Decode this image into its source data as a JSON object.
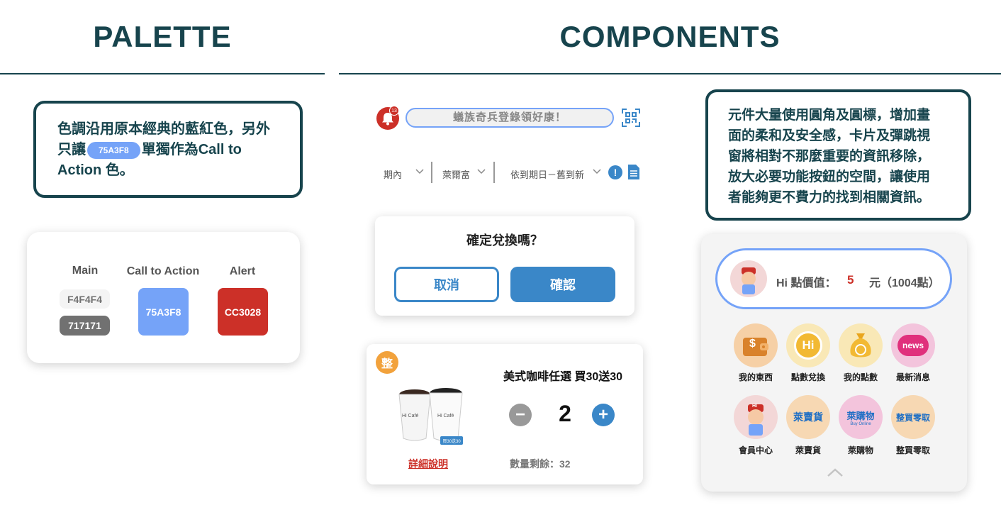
{
  "headings": {
    "palette": "PALETTE",
    "components": "COMPONENTS"
  },
  "palette_note": {
    "line1": "色調沿用原本經典的藍紅色，另外",
    "line2_pre": "只讓",
    "line2_pill": "75A3F8",
    "line2_post": "單獨作為Call to",
    "line3": "Action 色。"
  },
  "palette_card": {
    "main_label": "Main",
    "cta_label": "Call to Action",
    "alert_label": "Alert",
    "main_light": "F4F4F4",
    "main_dark": "717171",
    "cta": "75A3F8",
    "alert": "CC3028"
  },
  "colors": {
    "dark_teal": "#17444d",
    "main_light": "#F4F4F4",
    "main_dark": "#717171",
    "cta": "#75A3F8",
    "alert": "#CC3028",
    "primary_blue": "#3A87C8",
    "orange": "#F2A23C"
  },
  "topbar": {
    "badge_count": "13",
    "search_text": "蟻族奇兵登錄領好康！",
    "bell_icon": "bell-icon",
    "qr_icon": "qr-scan-icon"
  },
  "filters": {
    "period": "期內",
    "store": "萊爾富",
    "sort": "依到期日－舊到新"
  },
  "confirm_dialog": {
    "title": "確定兌換嗎？",
    "cancel": "取消",
    "confirm": "確認"
  },
  "product_card": {
    "badge": "整",
    "title": "美式咖啡任選 買30送30",
    "quantity": "2",
    "details_link": "詳細說明",
    "remaining": "數量剩餘：32",
    "tag": "買30送30",
    "cup_brand": "Hi Café"
  },
  "components_note": {
    "line1": "元件大量使用圓角及圓標，增加畫",
    "line2": "面的柔和及安全感，卡片及彈跳視",
    "line3": "窗將相對不那麼重要的資訊移除，",
    "line4": "放大必要功能按鈕的空間，讓使用",
    "line5": "者能夠更不費力的找到相關資訊。"
  },
  "points": {
    "label": "Hi 點價值：",
    "value": "5",
    "unit": "元（1004點）"
  },
  "menu": [
    {
      "label": "我的東西",
      "icon": "wallet-icon"
    },
    {
      "label": "點數兌換",
      "icon": "hi-coin-icon"
    },
    {
      "label": "我的點數",
      "icon": "money-bag-icon"
    },
    {
      "label": "最新消息",
      "icon": "news-icon"
    },
    {
      "label": "會員中心",
      "icon": "mascot-icon"
    },
    {
      "label": "萊賣貨",
      "icon": "lai-sell-icon",
      "logo_text": "萊賣貨"
    },
    {
      "label": "萊購物",
      "icon": "lai-shop-icon",
      "logo_text": "萊購物"
    },
    {
      "label": "整買零取",
      "icon": "bulk-buy-icon",
      "logo_text": "整買零取"
    }
  ],
  "menu_extras": {
    "news_logo": "news",
    "hi_logo": "Hi",
    "mascot_cap": "Hi",
    "wallet_symbol": "$",
    "lai_shop_sub": "Buy Online"
  }
}
